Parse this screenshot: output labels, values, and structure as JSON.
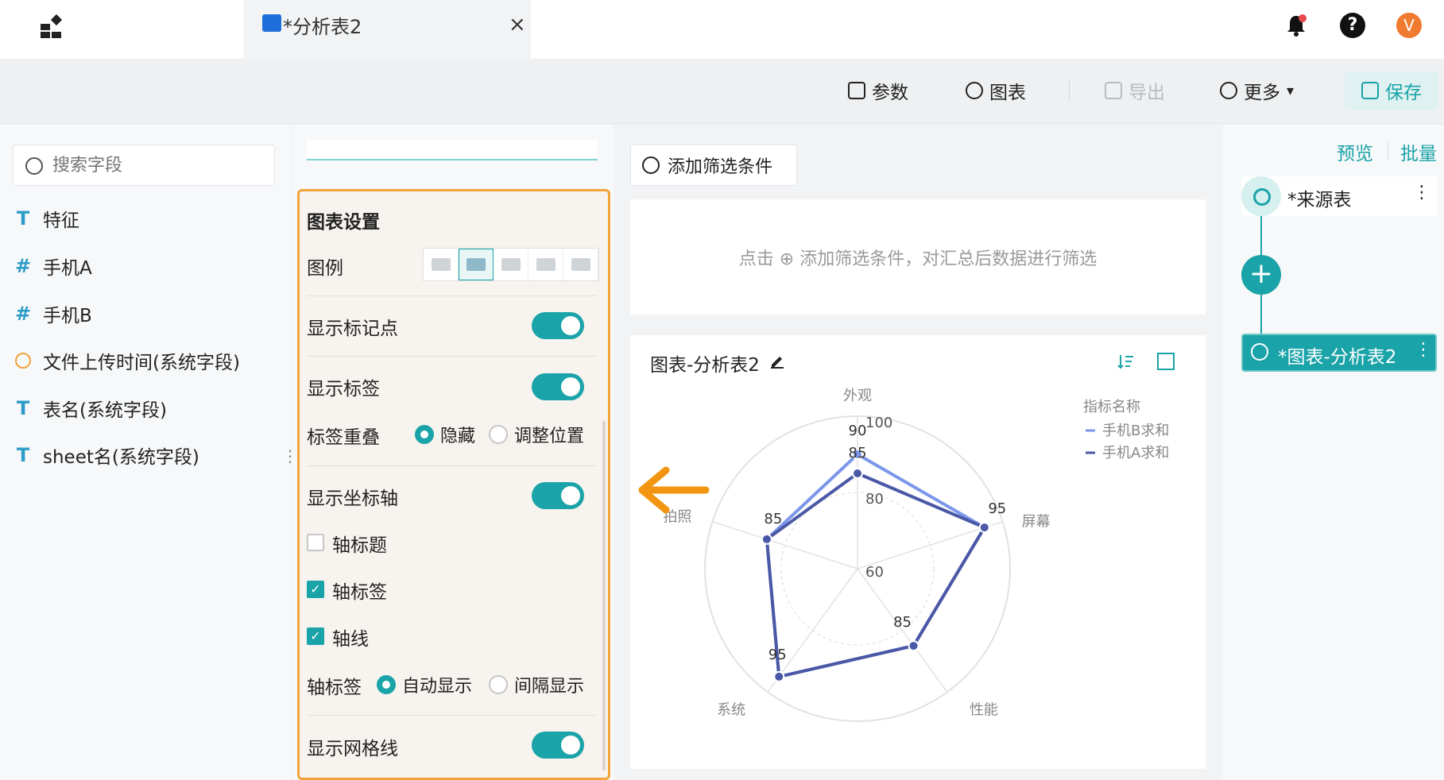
{
  "tab": {
    "title": "*分析表2",
    "close": "×"
  },
  "header": {
    "avatar_letter": "V",
    "help": "?"
  },
  "toolbar": {
    "params": "参数",
    "chart": "图表",
    "export": "导出",
    "more": "更多",
    "more_caret": "▾",
    "save": "保存"
  },
  "fields": {
    "search_placeholder": "搜索字段",
    "items": [
      {
        "type_icon": "T",
        "label": "特征"
      },
      {
        "type_icon": "#",
        "label": "手机A"
      },
      {
        "type_icon": "#",
        "label": "手机B"
      },
      {
        "type_icon": "clock",
        "label": "文件上传时间(系统字段)"
      },
      {
        "type_icon": "T",
        "label": "表名(系统字段)"
      },
      {
        "type_icon": "T",
        "label": "sheet名(系统字段)"
      }
    ],
    "more_dots": "⋮"
  },
  "settings": {
    "title": "图表设置",
    "legend_label": "图例",
    "show_markers": "显示标记点",
    "show_labels": "显示标签",
    "label_overlap": "标签重叠",
    "overlap_hide": "隐藏",
    "overlap_adjust": "调整位置",
    "show_axis": "显示坐标轴",
    "axis_title": "轴标题",
    "axis_labels": "轴标签",
    "axis_line": "轴线",
    "axis_label_mode": "轴标签",
    "auto_display": "自动显示",
    "interval_display": "间隔显示",
    "show_grid": "显示网格线",
    "state": {
      "show_markers": true,
      "show_labels": true,
      "overlap": "hide",
      "show_axis": true,
      "axis_title": false,
      "axis_labels": true,
      "axis_line": true,
      "axis_label_mode": "auto",
      "show_grid": true,
      "legend_selected_index": 1
    }
  },
  "filter": {
    "add_button": "添加筛选条件",
    "hint": "点击 ⊕ 添加筛选条件，对汇总后数据进行筛选"
  },
  "chart_card": {
    "title": "图表-分析表2"
  },
  "right_panel": {
    "preview": "预览",
    "batch": "批量",
    "source_node": "*来源表",
    "chart_node": "*图表-分析表2",
    "add": "+",
    "dots": "⋮"
  },
  "colors": {
    "accent": "#1aa3a8",
    "highlight_border": "#f2a33a",
    "series_a": "#4a58a6",
    "series_b": "#7b96ea"
  },
  "chart_data": {
    "type": "radar",
    "indicators": [
      "外观",
      "屏幕",
      "性能",
      "系统",
      "拍照"
    ],
    "radial_ticks": [
      60,
      80,
      100
    ],
    "range": [
      60,
      100
    ],
    "legend_title": "指标名称",
    "series": [
      {
        "name": "手机B求和",
        "values": [
          90,
          95,
          85,
          95,
          85
        ]
      },
      {
        "name": "手机A求和",
        "values": [
          85,
          95,
          85,
          95,
          85
        ]
      }
    ],
    "data_labels": {
      "外观": [
        "90",
        "85"
      ],
      "屏幕": [
        "95"
      ],
      "性能": [
        "85"
      ],
      "系统": [
        "95"
      ],
      "拍照": [
        "85"
      ]
    }
  }
}
